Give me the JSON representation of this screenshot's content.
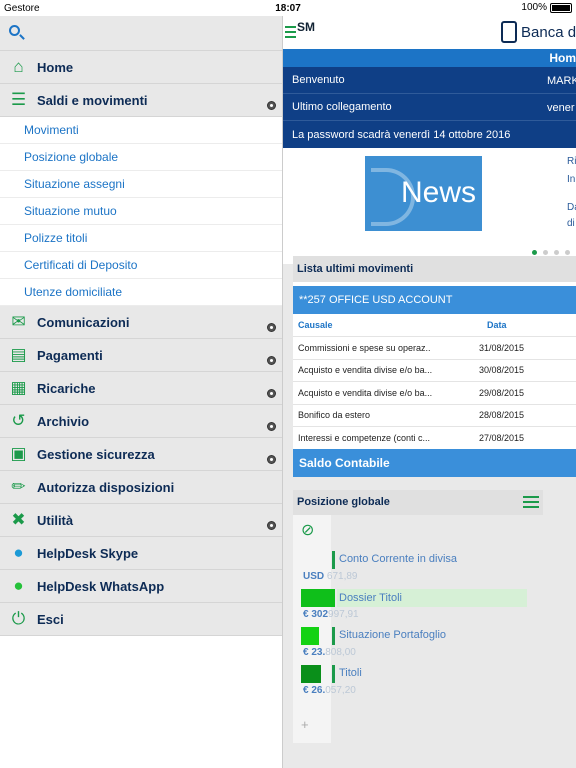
{
  "status_bar": {
    "carrier": "Gestore",
    "time": "18:07",
    "battery": "100%"
  },
  "sidebar": {
    "menu": [
      {
        "label": "Home",
        "icon": "home-icon",
        "badge": false
      },
      {
        "label": "Saldi e movimenti",
        "icon": "list-icon",
        "badge": true
      },
      {
        "label": "Comunicazioni",
        "icon": "inbox-icon",
        "badge": true
      },
      {
        "label": "Pagamenti",
        "icon": "payments-icon",
        "badge": true
      },
      {
        "label": "Ricariche",
        "icon": "recharge-icon",
        "badge": true
      },
      {
        "label": "Archivio",
        "icon": "history-icon",
        "badge": true
      },
      {
        "label": "Gestione sicurezza",
        "icon": "lock-icon",
        "badge": true
      },
      {
        "label": "Autorizza disposizioni",
        "icon": "stamp-icon",
        "badge": false
      },
      {
        "label": "Utilità",
        "icon": "tools-icon",
        "badge": true
      },
      {
        "label": "HelpDesk Skype",
        "icon": "skype-icon",
        "badge": false
      },
      {
        "label": "HelpDesk WhatsApp",
        "icon": "whatsapp-icon",
        "badge": false
      },
      {
        "label": "Esci",
        "icon": "power-icon",
        "badge": false
      }
    ],
    "submenu": [
      "Movimenti",
      "Posizione globale",
      "Situazione assegni",
      "Situazione mutuo",
      "Polizze titoli",
      "Certificati di Deposito",
      "Utenze domiciliate"
    ]
  },
  "header": {
    "logo_text": "SM",
    "bank_name": "Banca di",
    "home_label": "Hom"
  },
  "info": {
    "welcome_label": "Benvenuto",
    "welcome_value": "MARK",
    "last_login_label": "Ultimo collegamento",
    "last_login_value": "vener",
    "password_notice": "La password scadrà venerdì 14 ottobre 2016"
  },
  "news": {
    "image_text": "News",
    "side_1": "Ri",
    "side_2": "In",
    "side_3": "Da",
    "side_4": "di"
  },
  "movements": {
    "title": "Lista ultimi movimenti",
    "account": "**257 OFFICE USD ACCOUNT",
    "col_causale": "Causale",
    "col_data": "Data",
    "rows": [
      {
        "causale": "Commissioni e spese su operaz..",
        "data": "31/08/2015"
      },
      {
        "causale": "Acquisto e vendita divise e/o ba...",
        "data": "30/08/2015"
      },
      {
        "causale": "Acquisto e vendita divise e/o ba...",
        "data": "29/08/2015"
      },
      {
        "causale": "Bonifico da estero",
        "data": "28/08/2015"
      },
      {
        "causale": "Interessi e competenze (conti c...",
        "data": "27/08/2015"
      }
    ],
    "saldo_label": "Saldo Contabile"
  },
  "positions": {
    "title": "Posizione globale",
    "items": [
      {
        "label": "Conto Corrente in divisa",
        "amount_prefix": "USD ",
        "amount_rest": "671,89",
        "bar_color": "#1b9a4a"
      },
      {
        "label": "Dossier Titoli",
        "amount_prefix": "€ 302",
        "amount_rest": "997,91",
        "bar_color": "#0fbf1a"
      },
      {
        "label": "Situazione Portafoglio",
        "amount_prefix": "€ 23.",
        "amount_rest": "808,00",
        "bar_color": "#14d214"
      },
      {
        "label": "Titoli",
        "amount_prefix": "€ 26.",
        "amount_rest": "057,20",
        "bar_color": "#0a8f1a"
      }
    ],
    "plus": "+"
  }
}
